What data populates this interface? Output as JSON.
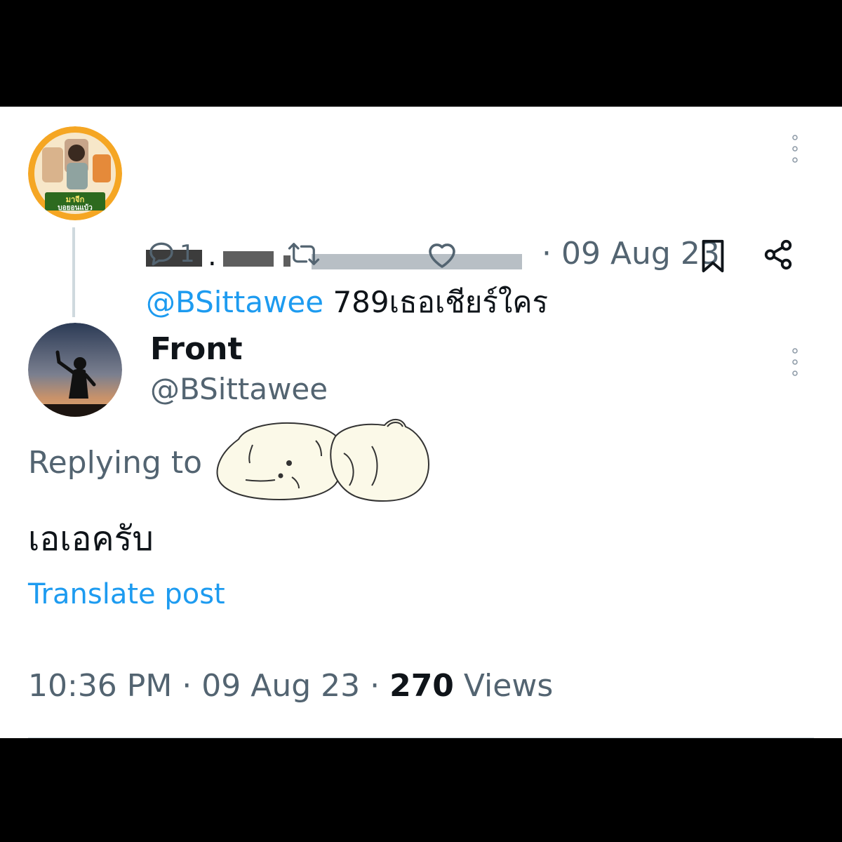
{
  "parent_tweet": {
    "date": "· 09 Aug 23",
    "mention": "@BSittawee",
    "text": " 789เธอเชียร์ใคร",
    "reply_count": "1"
  },
  "reply_tweet": {
    "name": "Front",
    "handle": "@BSittawee",
    "replying_to": "Replying to",
    "text": "เอเอครับ",
    "translate": "Translate post",
    "time": "10:36 PM · 09 Aug 23 · ",
    "views_count": "270",
    "views_label": " Views"
  },
  "colors": {
    "link_blue": "#1d9bf0",
    "secondary_text": "#536471",
    "primary_text": "#0f1419",
    "avatar_ring": "#f5a623"
  },
  "icons": [
    "reply-icon",
    "retweet-icon",
    "like-icon",
    "bookmark-icon",
    "share-icon",
    "more-icon"
  ]
}
